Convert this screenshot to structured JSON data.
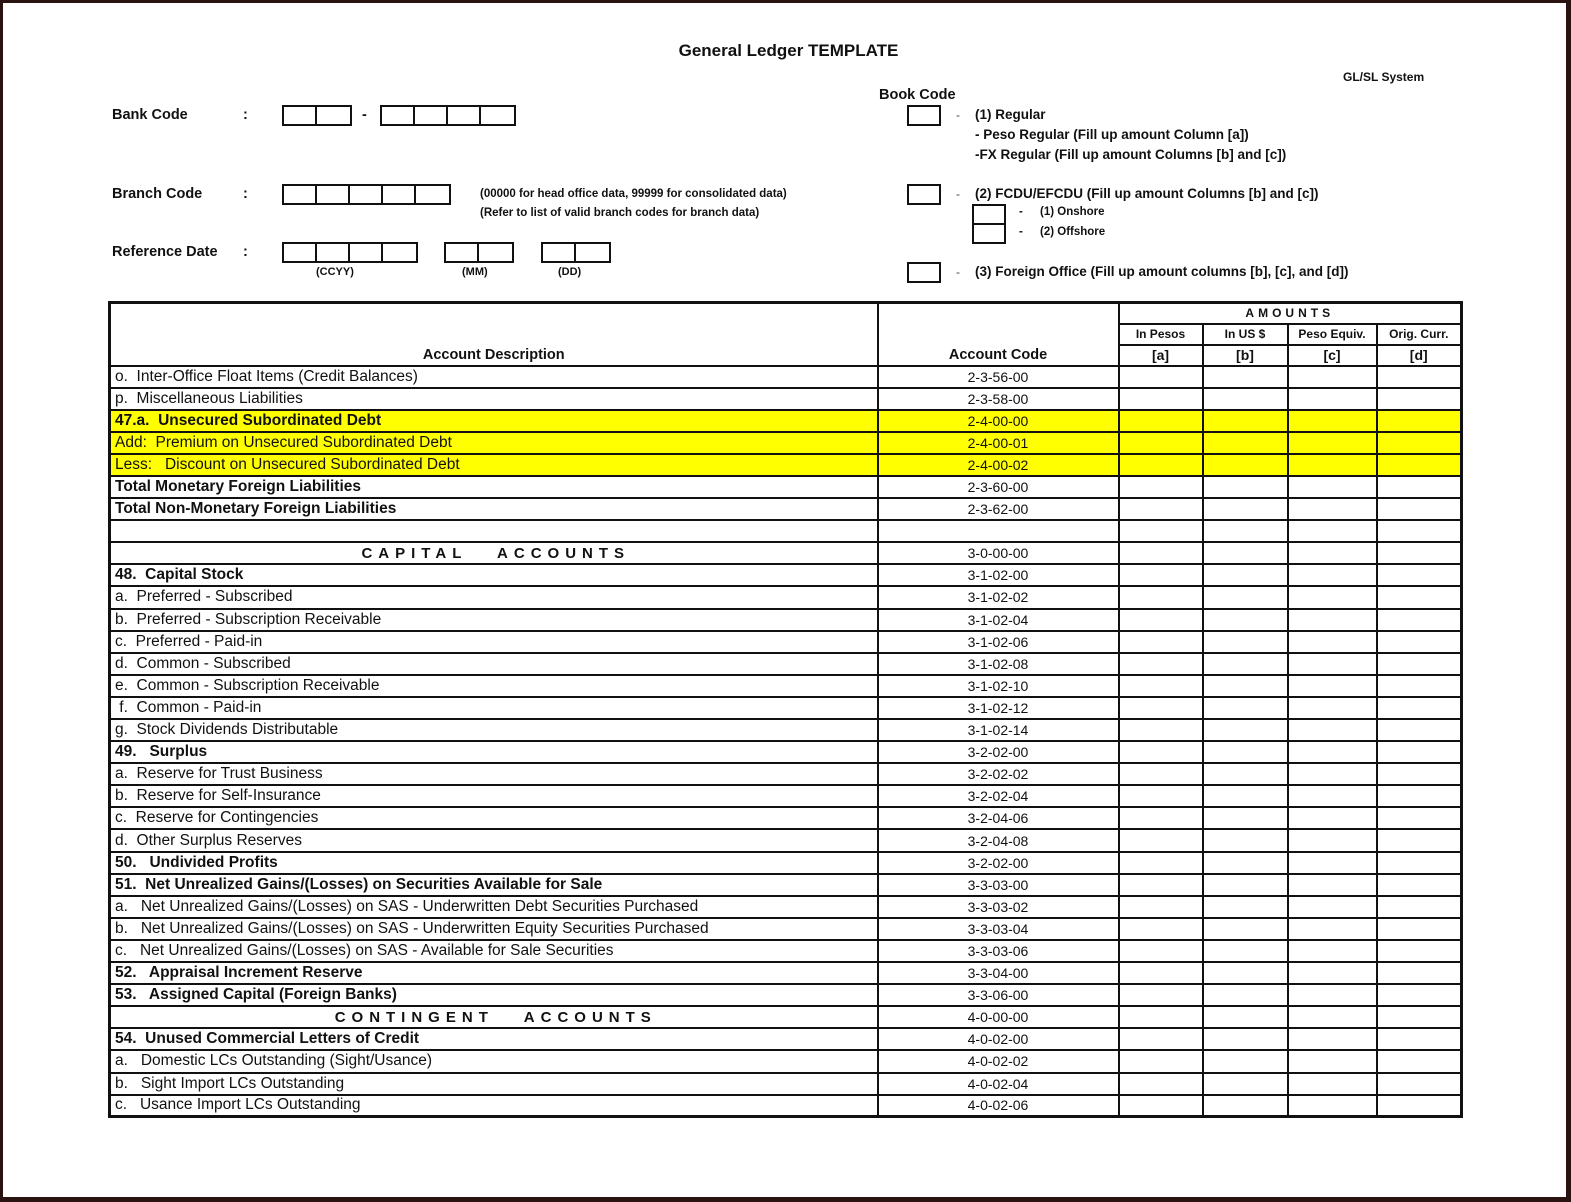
{
  "document": {
    "title": "General Ledger TEMPLATE",
    "system_label": "GL/SL System"
  },
  "header_fields": {
    "bank_code": {
      "label": "Bank Code",
      "colon": ":",
      "separator": "-"
    },
    "branch_code": {
      "label": "Branch Code",
      "colon": ":",
      "note_1": "(00000 for head office data, 99999 for consolidated data)",
      "note_2": "(Refer to list of valid branch codes for branch data)"
    },
    "reference_date": {
      "label": "Reference Date",
      "colon": ":",
      "year_label": "(CCYY)",
      "month_label": "(MM)",
      "day_label": "(DD)"
    }
  },
  "book_code": {
    "label": "Book Code",
    "dash": "-",
    "option_1": "(1) Regular",
    "option_1_sub_1": "- Peso Regular (Fill up amount Column [a])",
    "option_1_sub_2": "-FX Regular (Fill up amount Columns [b] and [c])",
    "option_2": "(2) FCDU/EFCDU (Fill up amount Columns [b] and [c])",
    "option_2_sub_1": "(1) Onshore",
    "option_2_sub_2": "(2) Offshore",
    "option_3": "(3) Foreign Office (Fill up amount columns [b], [c], and [d])"
  },
  "table": {
    "headers": {
      "description": "Account Description",
      "code": "Account Code",
      "amounts": "AMOUNTS",
      "columns": [
        {
          "label": "In Pesos",
          "key": "[a]"
        },
        {
          "label": "In US $",
          "key": "[b]"
        },
        {
          "label": "Peso Equiv.",
          "key": "[c]"
        },
        {
          "label": "Orig. Curr.",
          "key": "[d]"
        }
      ]
    },
    "highlight_color": "#ffff00",
    "rows": [
      {
        "description": "o.  Inter-Office Float Items (Credit Balances)",
        "code": "2-3-56-00",
        "style": "ind1"
      },
      {
        "description": "p.  Miscellaneous Liabilities",
        "code": "2-3-58-00",
        "style": "ind1"
      },
      {
        "description": "47.a.  Unsecured Subordinated Debt",
        "code": "2-4-00-00",
        "style": "bold hl"
      },
      {
        "description": "Add:  Premium on Unsecured Subordinated Debt",
        "code": "2-4-00-01",
        "style": "ind3 hl"
      },
      {
        "description": "Less:   Discount on Unsecured Subordinated Debt",
        "code": "2-4-00-02",
        "style": "ind3 hl"
      },
      {
        "description": "Total Monetary Foreign Liabilities",
        "code": "2-3-60-00",
        "style": "bold"
      },
      {
        "description": "Total Non-Monetary Foreign Liabilities",
        "code": "2-3-62-00",
        "style": "bold"
      },
      {
        "description": "",
        "code": "",
        "style": ""
      },
      {
        "description": "CAPITAL   ACCOUNTS",
        "code": "3-0-00-00",
        "style": "section"
      },
      {
        "description": "48.  Capital Stock",
        "code": "3-1-02-00",
        "style": "bold"
      },
      {
        "description": "a.  Preferred - Subscribed",
        "code": "3-1-02-02",
        "style": "ind2"
      },
      {
        "description": "b.  Preferred - Subscription Receivable",
        "code": "3-1-02-04",
        "style": "ind2"
      },
      {
        "description": "c.  Preferred - Paid-in",
        "code": "3-1-02-06",
        "style": "ind2"
      },
      {
        "description": "d.  Common - Subscribed",
        "code": "3-1-02-08",
        "style": "ind2"
      },
      {
        "description": "e.  Common - Subscription Receivable",
        "code": "3-1-02-10",
        "style": "ind2"
      },
      {
        "description": " f.  Common - Paid-in",
        "code": "3-1-02-12",
        "style": "ind2"
      },
      {
        "description": "g.  Stock Dividends Distributable",
        "code": "3-1-02-14",
        "style": "ind2"
      },
      {
        "description": "49.   Surplus",
        "code": "3-2-02-00",
        "style": "bold"
      },
      {
        "description": "a.  Reserve for Trust Business",
        "code": "3-2-02-02",
        "style": "ind2"
      },
      {
        "description": "b.  Reserve for Self-Insurance",
        "code": "3-2-02-04",
        "style": "ind2"
      },
      {
        "description": "c.  Reserve for Contingencies",
        "code": "3-2-04-06",
        "style": "ind2"
      },
      {
        "description": "d.  Other Surplus Reserves",
        "code": "3-2-04-08",
        "style": "ind2"
      },
      {
        "description": "50.   Undivided Profits",
        "code": "3-2-02-00",
        "style": "bold"
      },
      {
        "description": "51.  Net Unrealized Gains/(Losses) on Securities Available for Sale",
        "code": "3-3-03-00",
        "style": "bold"
      },
      {
        "description": "a.   Net Unrealized Gains/(Losses) on SAS - Underwritten Debt Securities Purchased",
        "code": "3-3-03-02",
        "style": "ind2"
      },
      {
        "description": "b.   Net Unrealized Gains/(Losses) on SAS - Underwritten Equity Securities Purchased",
        "code": "3-3-03-04",
        "style": "ind2"
      },
      {
        "description": "c.   Net Unrealized Gains/(Losses) on SAS - Available for Sale Securities",
        "code": "3-3-03-06",
        "style": "ind2"
      },
      {
        "description": "52.   Appraisal Increment Reserve",
        "code": "3-3-04-00",
        "style": "bold"
      },
      {
        "description": "53.   Assigned Capital (Foreign Banks)",
        "code": "3-3-06-00",
        "style": "bold"
      },
      {
        "description": "CONTINGENT   ACCOUNTS",
        "code": "4-0-00-00",
        "style": "section"
      },
      {
        "description": "54.  Unused Commercial Letters of Credit",
        "code": "4-0-02-00",
        "style": "bold"
      },
      {
        "description": "a.   Domestic LCs Outstanding (Sight/Usance)",
        "code": "4-0-02-02",
        "style": "ind2"
      },
      {
        "description": "b.   Sight Import LCs Outstanding",
        "code": "4-0-02-04",
        "style": "ind2"
      },
      {
        "description": "c.   Usance Import LCs Outstanding",
        "code": "4-0-02-06",
        "style": "ind2"
      }
    ]
  }
}
